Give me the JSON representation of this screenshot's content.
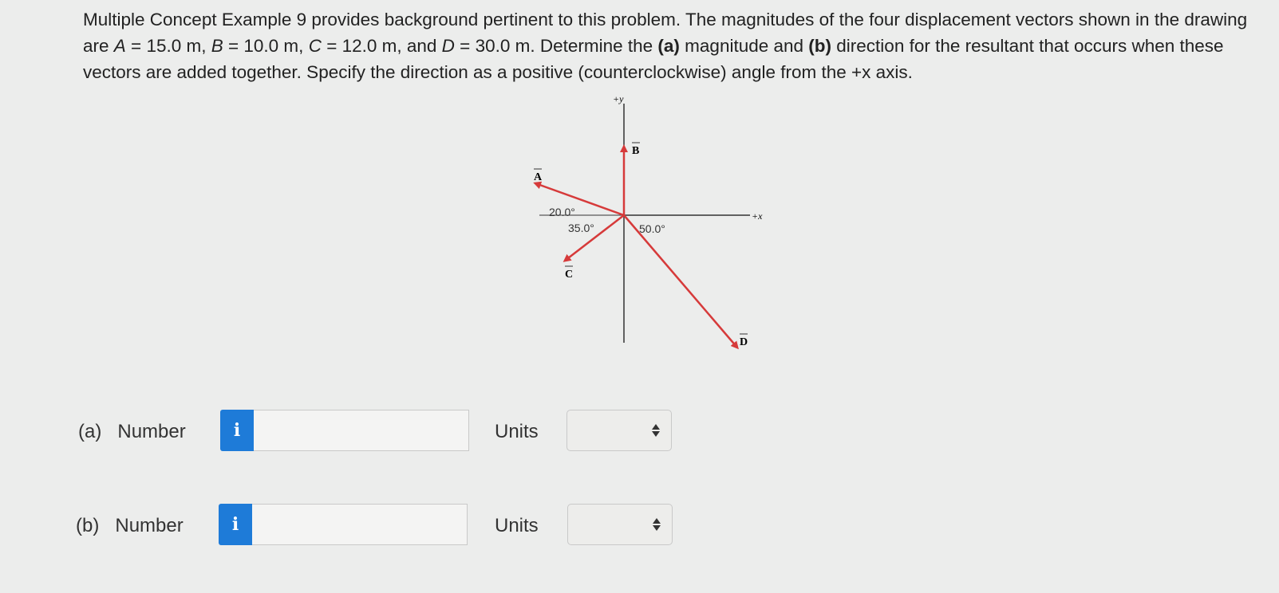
{
  "problem": {
    "part1": "Multiple Concept Example 9 provides background pertinent to this problem. The magnitudes of the four displacement vectors shown in the drawing are ",
    "A_sym": "A",
    "A_val": " = 15.0 m, ",
    "B_sym": "B",
    "B_val": " = 10.0 m, ",
    "C_sym": "C",
    "C_val": " = 12.0 m, and ",
    "D_sym": "D",
    "D_val": " = 30.0 m. Determine the ",
    "a_tag": "(a)",
    "mid": " magnitude and ",
    "b_tag": "(b)",
    "end": " direction for the resultant that occurs when these vectors are added together. Specify the direction as a positive (counterclockwise) angle from the +x axis."
  },
  "figure": {
    "y_axis_label": "+y",
    "x_axis_label": "+x",
    "vector_labels": [
      "A",
      "B",
      "C",
      "D"
    ],
    "angle_labels": [
      "20.0°",
      "35.0°",
      "50.0°"
    ],
    "colors": {
      "vector": "#d63a3a",
      "axis": "#333333"
    }
  },
  "answers": [
    {
      "part": "(a)",
      "label": "Number",
      "info_icon": "i",
      "value": "",
      "units_label": "Units",
      "units_value": ""
    },
    {
      "part": "(b)",
      "label": "Number",
      "info_icon": "i",
      "value": "",
      "units_label": "Units",
      "units_value": ""
    }
  ]
}
